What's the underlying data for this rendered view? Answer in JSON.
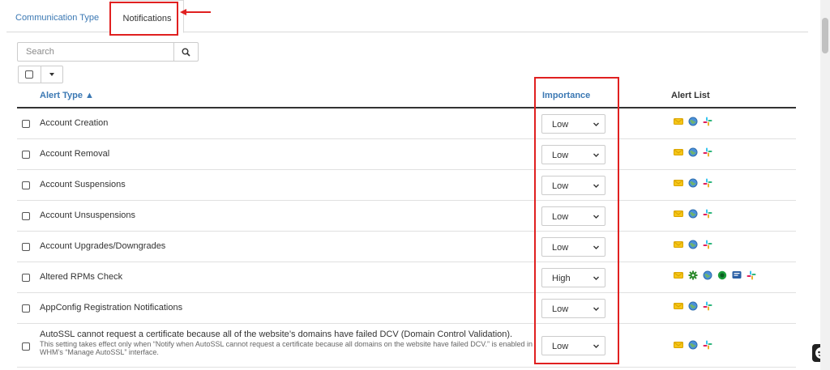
{
  "tabs": {
    "communication": "Communication Type",
    "notifications": "Notifications"
  },
  "search": {
    "placeholder": "Search"
  },
  "table": {
    "headers": {
      "alert_type": "Alert Type ▲",
      "importance": "Importance",
      "alert_list": "Alert List"
    },
    "rows": [
      {
        "label": "Account Creation",
        "importance": "Low"
      },
      {
        "label": "Account Removal",
        "importance": "Low"
      },
      {
        "label": "Account Suspensions",
        "importance": "Low"
      },
      {
        "label": "Account Unsuspensions",
        "importance": "Low"
      },
      {
        "label": "Account Upgrades/Downgrades",
        "importance": "Low"
      },
      {
        "label": "Altered RPMs Check",
        "importance": "High"
      },
      {
        "label": "AppConfig Registration Notifications",
        "importance": "Low"
      },
      {
        "label": "AutoSSL cannot request a certificate because all of the website’s domains have failed DCV (Domain Control Validation).",
        "description": "This setting takes effect only when “Notify when AutoSSL cannot request a certificate because all domains on the website have failed DCV.” is enabled in WHM’s “Manage AutoSSL” interface.",
        "importance": "Low"
      }
    ]
  },
  "colors": {
    "link": "#3b78b3",
    "highlight": "#e02020",
    "email": "#f5c518",
    "slack": "multicolor"
  },
  "icons": [
    "email-icon",
    "globe-icon",
    "slack-icon",
    "gear-icon",
    "circle-icon",
    "chat-icon"
  ]
}
